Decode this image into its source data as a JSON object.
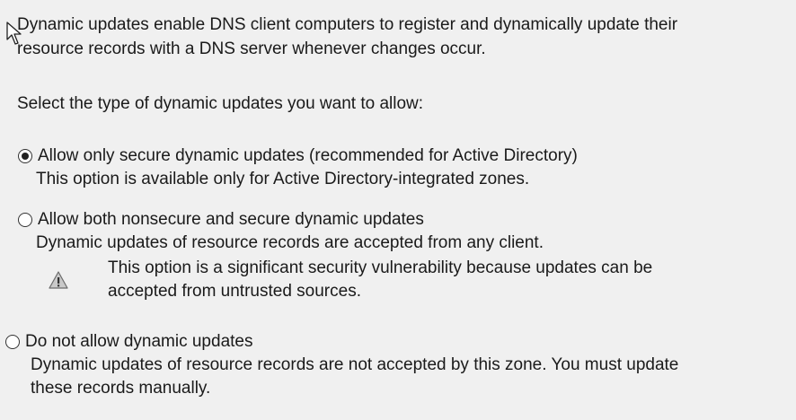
{
  "intro": {
    "line1": "Dynamic updates enable DNS client computers to register and dynamically update their",
    "line2": "resource records with a DNS server whenever changes occur."
  },
  "prompt": "Select the type of dynamic updates you want to allow:",
  "options": [
    {
      "label": "Allow only secure dynamic updates (recommended for Active Directory)",
      "description": "This option is available only for Active Directory-integrated zones.",
      "selected": true
    },
    {
      "label": "Allow both nonsecure and secure dynamic updates",
      "description": "Dynamic updates of resource records are accepted from any client.",
      "warning": {
        "icon": "warning-icon",
        "line1": "This option is a significant security vulnerability because updates can be",
        "line2": "accepted from untrusted sources."
      },
      "selected": false
    },
    {
      "label": "Do not allow dynamic updates",
      "description_line1": "Dynamic updates of resource records are not accepted by this zone. You must update",
      "description_line2": "these records manually.",
      "selected": false
    }
  ]
}
